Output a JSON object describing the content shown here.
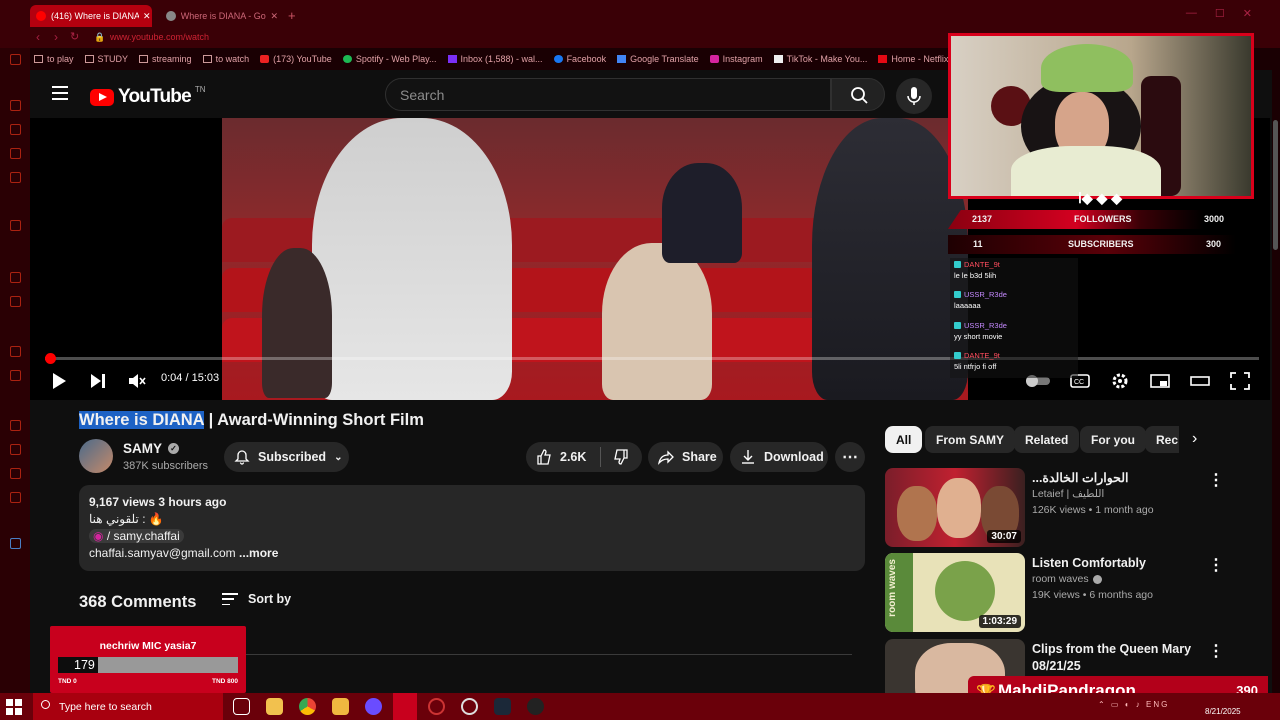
{
  "browser": {
    "tabs": [
      {
        "label": "(416) Where is DIANA | Aw",
        "active": true
      },
      {
        "label": "Where is DIANA - Google",
        "active": false
      }
    ],
    "url": "www.youtube.com/watch",
    "bookmarks": [
      "to play",
      "STUDY",
      "streaming",
      "to watch",
      "(173) YouTube",
      "Spotify - Web Play...",
      "Inbox (1,588) - wal...",
      "Facebook",
      "Google Translate",
      "Instagram",
      "TikTok - Make You...",
      "Home - Netflix"
    ]
  },
  "youtube": {
    "logo_text": "YouTube",
    "logo_region": "TN",
    "search_placeholder": "Search"
  },
  "player": {
    "time": "0:04 / 15:03",
    "progress_fraction": 0.0044
  },
  "stream_overlay": {
    "stats": [
      {
        "current": "2137",
        "label": "FOLLOWERS",
        "goal": "3000"
      },
      {
        "current": "11",
        "label": "SUBSCRIBERS",
        "goal": "300"
      }
    ],
    "chat": [
      {
        "user": "DANTE_9t",
        "text": "le le b3d 5lih",
        "color": "#ff4d5e"
      },
      {
        "user": "USSR_R3de",
        "text": "laaaaaa",
        "color": "#c58aff"
      },
      {
        "user": "USSR_R3de",
        "text": "yy short movie",
        "color": "#c58aff"
      },
      {
        "user": "DANTE_9t",
        "text": "5li ntfrjo fi off",
        "color": "#ff4d5e"
      }
    ]
  },
  "video": {
    "title_highlight": "Where is DIANA",
    "title_rest": " | Award-Winning Short Film",
    "channel": "SAMY",
    "subscribers": "387K subscribers",
    "subscribe_label": "Subscribed",
    "likes": "2.6K",
    "share_label": "Share",
    "download_label": "Download"
  },
  "description": {
    "meta": "9,167 views  3 hours ago",
    "line2": "تلقوني هنا : 🔥",
    "instagram": "/ samy.chaffai",
    "email": "chaffai.samyav@gmail.com",
    "more": "...more"
  },
  "comments": {
    "count_label": "368 Comments",
    "sort_label": "Sort by"
  },
  "donation_goal": {
    "title": "nechriw MIC yasia7",
    "value": "179",
    "min": "TND 0",
    "max": "TND 800",
    "fill_fraction": 0.224
  },
  "chips": [
    "All",
    "From SAMY",
    "Related",
    "For you",
    "Rec"
  ],
  "recommendations": [
    {
      "title": "الحوارات الخالدة...",
      "channel": "Letaief | اللطيف",
      "meta": "126K views • 1 month ago",
      "duration": "30:07",
      "verified": false
    },
    {
      "title": "Listen Comfortably",
      "channel": "room waves",
      "meta": "19K views • 6 months ago",
      "duration": "1:03:29",
      "verified": true,
      "thumb_text": "room waves"
    },
    {
      "title": "Clips from the Queen Mary 08/21/25",
      "channel": "",
      "meta": "",
      "duration": "",
      "verified": false
    }
  ],
  "top_donor": {
    "name": "MahdiPandragon",
    "value": "390"
  },
  "taskbar": {
    "search_placeholder": "Type here to search",
    "date": "8/21/2025"
  },
  "colors": {
    "accent": "#ff0000",
    "overlay_red": "#c8001d",
    "taskbar": "#6a000a"
  }
}
